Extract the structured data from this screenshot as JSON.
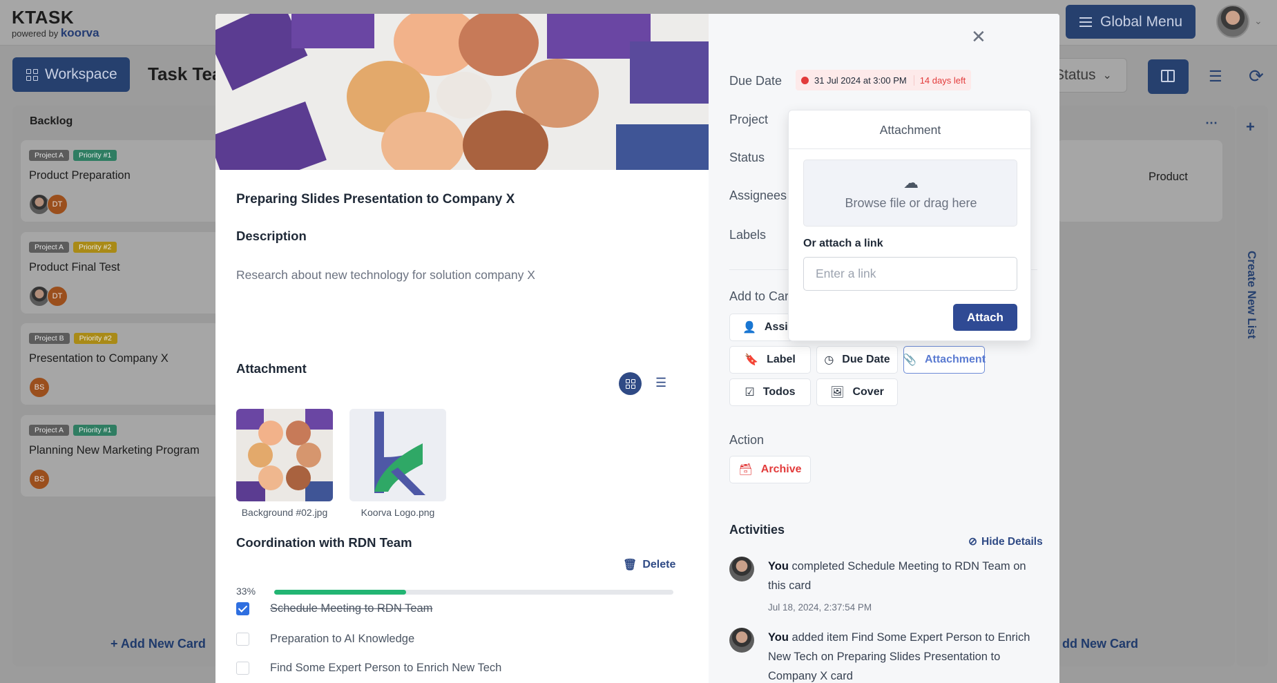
{
  "app": {
    "logo_name": "KTASK",
    "logo_powered": "powered by",
    "logo_brand": "koorva",
    "global_menu_label": "Global Menu"
  },
  "toolbar": {
    "workspace_label": "Workspace",
    "board_title": "Task Tea",
    "status_label": "Status"
  },
  "board": {
    "backlog_title": "Backlog",
    "cards": [
      {
        "project": "Project A",
        "priority": "Priority #1",
        "title": "Product Preparation",
        "assignees": [
          "photo",
          "DT"
        ]
      },
      {
        "project": "Project A",
        "priority": "Priority #2",
        "title": "Product Final Test",
        "assignees": [
          "photo",
          "DT"
        ]
      },
      {
        "project": "Project B",
        "priority": "Priority #2",
        "title": "Presentation to Company X",
        "assignees": [
          "BS"
        ]
      },
      {
        "project": "Project A",
        "priority": "Priority #1",
        "title": "Planning New Marketing Program",
        "assignees": [
          "BS"
        ]
      }
    ],
    "add_new_card": "Add New Card",
    "right_card_fragment": "Product",
    "right_add_new_card": "dd New Card",
    "create_new_list": "Create New List"
  },
  "modal": {
    "task_title": "Preparing Slides Presentation to Company X",
    "description_title": "Description",
    "description_text": "Research about new technology for solution company X",
    "attachment_title": "Attachment",
    "attachments": [
      {
        "name": "Background #02.jpg"
      },
      {
        "name": "Koorva Logo.png"
      }
    ],
    "checklist": {
      "title": "Coordination with RDN Team",
      "delete_label": "Delete",
      "percent_label": "33%",
      "progress": 0.33,
      "items": [
        {
          "text": "Schedule Meeting to RDN Team",
          "checked": true
        },
        {
          "text": "Preparation to AI Knowledge",
          "checked": false
        },
        {
          "text": "Find Some Expert Person to Enrich New Tech",
          "checked": false
        }
      ]
    }
  },
  "details": {
    "due_date_label": "Due Date",
    "due_date_value": "31 Jul 2024 at 3:00 PM",
    "due_date_remaining": "14 days left",
    "project_label": "Project",
    "status_label": "Status",
    "assignees_label": "Assignees",
    "labels_label": "Labels",
    "add_to_card_label": "Add to Car",
    "buttons": {
      "assign": "Assig",
      "label": "Label",
      "due_date": "Due Date",
      "attachment": "Attachment",
      "todos": "Todos",
      "cover": "Cover"
    },
    "action_label": "Action",
    "archive_label": "Archive",
    "activities_label": "Activities",
    "hide_details": "Hide Details",
    "activities": [
      {
        "actor": "You",
        "text": " completed Schedule Meeting to RDN Team on this card",
        "time": "Jul 18, 2024, 2:37:54 PM"
      },
      {
        "actor": "You",
        "text": " added item Find Some Expert Person to Enrich New Tech on Preparing Slides Presentation to Company X card",
        "time": ""
      }
    ]
  },
  "popover": {
    "title": "Attachment",
    "dropzone_text": "Browse file or drag here",
    "or_link_label": "Or attach a link",
    "link_placeholder": "Enter a link",
    "link_value": "",
    "attach_button": "Attach"
  },
  "colors": {
    "brand_navy": "#26406e",
    "primary_button": "#2f4a94",
    "progress_fill": "#22b573",
    "danger": "#e23b3b",
    "checkbox_checked": "#2f6fe0"
  }
}
